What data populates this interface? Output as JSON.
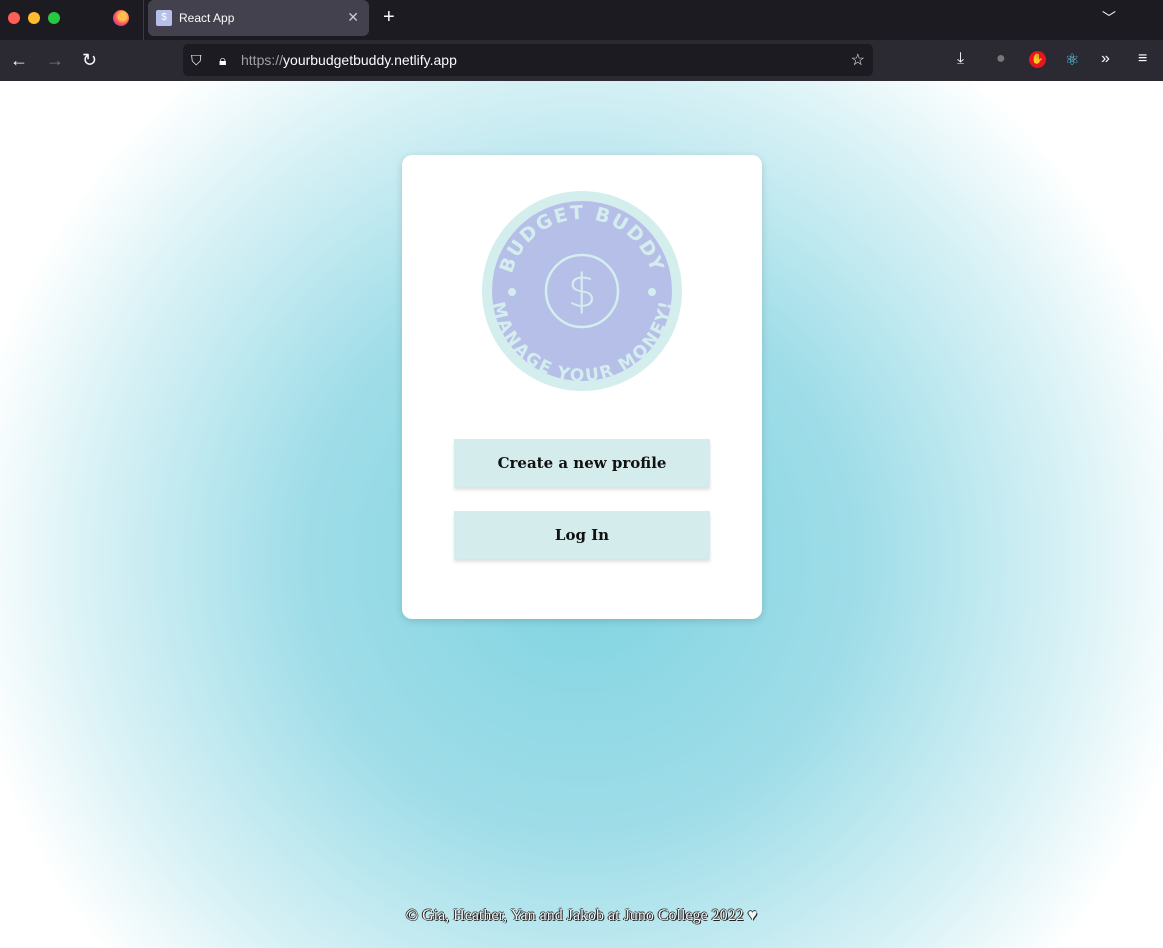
{
  "browser": {
    "tab_title": "React App",
    "url_scheme": "https://",
    "url_host": "yourbudgetbuddy.netlify.app"
  },
  "logo": {
    "top_text": "BUDGET BUDDY",
    "bottom_text": "MANAGE YOUR MONEY!",
    "ring_color": "#d4eeee",
    "fill_color": "#b6bfe8"
  },
  "actions": {
    "create_label": "Create a new profile",
    "login_label": "Log In"
  },
  "footer": {
    "text": "© Gia, Heather, Yan and Jakob at Juno College 2022 ♥"
  }
}
